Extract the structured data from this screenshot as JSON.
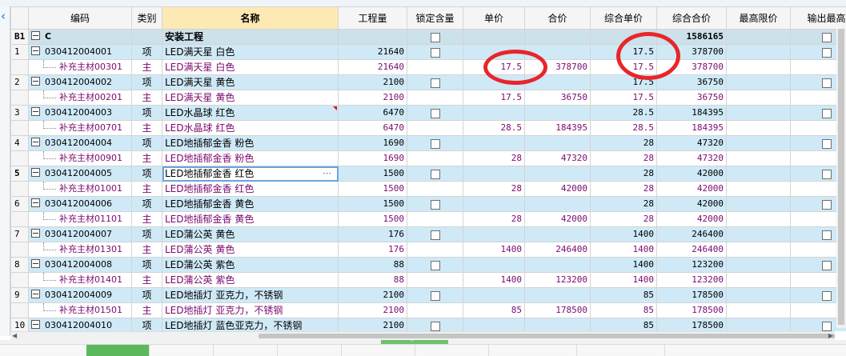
{
  "columns": [
    "编码",
    "类别",
    "名称",
    "工程量",
    "锁定含量",
    "单价",
    "合价",
    "综合单价",
    "综合合价",
    "最高限价",
    "输出最高"
  ],
  "rows": [
    {
      "rn": "B1",
      "code": "C",
      "type": "",
      "name": "安装工程",
      "qty": "",
      "lock": true,
      "price": "",
      "total": "",
      "cprice": "",
      "ctotal": "1586165",
      "kind": "group",
      "tree": true
    },
    {
      "rn": "1",
      "code": "030412004001",
      "type": "项",
      "name": "LED满天星 白色",
      "qty": "21640",
      "lock": true,
      "price": "",
      "total": "",
      "cprice": "17.5",
      "ctotal": "378700",
      "kind": "item",
      "tree": true
    },
    {
      "rn": "",
      "code": "补充主材00301",
      "type": "主",
      "name": "LED满天星 白色",
      "qty": "21640",
      "lock": false,
      "price": "17.5",
      "total": "378700",
      "cprice": "17.5",
      "ctotal": "378700",
      "kind": "sub"
    },
    {
      "rn": "2",
      "code": "030412004002",
      "type": "项",
      "name": "LED满天星 黄色",
      "qty": "2100",
      "lock": true,
      "price": "",
      "total": "",
      "cprice": "17.5",
      "ctotal": "36750",
      "kind": "item",
      "tree": true
    },
    {
      "rn": "",
      "code": "补充主材00201",
      "type": "主",
      "name": "LED满天星 黄色",
      "qty": "2100",
      "lock": false,
      "price": "17.5",
      "total": "36750",
      "cprice": "17.5",
      "ctotal": "36750",
      "kind": "sub"
    },
    {
      "rn": "3",
      "code": "030412004003",
      "type": "项",
      "name": "LED水晶球 红色",
      "qty": "6470",
      "lock": true,
      "price": "",
      "total": "",
      "cprice": "28.5",
      "ctotal": "184395",
      "kind": "item",
      "tree": true,
      "redmark": true
    },
    {
      "rn": "",
      "code": "补充主材00701",
      "type": "主",
      "name": "LED水晶球 红色",
      "qty": "6470",
      "lock": false,
      "price": "28.5",
      "total": "184395",
      "cprice": "28.5",
      "ctotal": "184395",
      "kind": "sub"
    },
    {
      "rn": "4",
      "code": "030412004004",
      "type": "项",
      "name": "LED地插郁金香 粉色",
      "qty": "1690",
      "lock": true,
      "price": "",
      "total": "",
      "cprice": "28",
      "ctotal": "47320",
      "kind": "item",
      "tree": true
    },
    {
      "rn": "",
      "code": "补充主材00901",
      "type": "主",
      "name": "LED地插郁金香 粉色",
      "qty": "1690",
      "lock": false,
      "price": "28",
      "total": "47320",
      "cprice": "28",
      "ctotal": "47320",
      "kind": "sub"
    },
    {
      "rn": "5",
      "code": "030412004005",
      "type": "项",
      "name": "LED地插郁金香 红色",
      "qty": "1500",
      "lock": true,
      "price": "",
      "total": "",
      "cprice": "28",
      "ctotal": "42000",
      "kind": "item",
      "tree": true,
      "current": true
    },
    {
      "rn": "",
      "code": "补充主材01001",
      "type": "主",
      "name": "LED地插郁金香 红色",
      "qty": "1500",
      "lock": false,
      "price": "28",
      "total": "42000",
      "cprice": "28",
      "ctotal": "42000",
      "kind": "sub"
    },
    {
      "rn": "6",
      "code": "030412004006",
      "type": "项",
      "name": "LED地插郁金香 黄色",
      "qty": "1500",
      "lock": true,
      "price": "",
      "total": "",
      "cprice": "28",
      "ctotal": "42000",
      "kind": "item",
      "tree": true
    },
    {
      "rn": "",
      "code": "补充主材01101",
      "type": "主",
      "name": "LED地插郁金香 黄色",
      "qty": "1500",
      "lock": false,
      "price": "28",
      "total": "42000",
      "cprice": "28",
      "ctotal": "42000",
      "kind": "sub"
    },
    {
      "rn": "7",
      "code": "030412004007",
      "type": "项",
      "name": "LED蒲公英 黄色",
      "qty": "176",
      "lock": true,
      "price": "",
      "total": "",
      "cprice": "1400",
      "ctotal": "246400",
      "kind": "item",
      "tree": true
    },
    {
      "rn": "",
      "code": "补充主材01301",
      "type": "主",
      "name": "LED蒲公英 黄色",
      "qty": "176",
      "lock": false,
      "price": "1400",
      "total": "246400",
      "cprice": "1400",
      "ctotal": "246400",
      "kind": "sub"
    },
    {
      "rn": "8",
      "code": "030412004008",
      "type": "项",
      "name": "LED蒲公英 紫色",
      "qty": "88",
      "lock": true,
      "price": "",
      "total": "",
      "cprice": "1400",
      "ctotal": "123200",
      "kind": "item",
      "tree": true
    },
    {
      "rn": "",
      "code": "补充主材01401",
      "type": "主",
      "name": "LED蒲公英 紫色",
      "qty": "88",
      "lock": false,
      "price": "1400",
      "total": "123200",
      "cprice": "1400",
      "ctotal": "123200",
      "kind": "sub"
    },
    {
      "rn": "9",
      "code": "030412004009",
      "type": "项",
      "name": "LED地插灯 亚克力，不锈钢",
      "qty": "2100",
      "lock": true,
      "price": "",
      "total": "",
      "cprice": "85",
      "ctotal": "178500",
      "kind": "item",
      "tree": true
    },
    {
      "rn": "",
      "code": "补充主材01501",
      "type": "主",
      "name": "LED地插灯 亚克力，不锈钢",
      "qty": "2100",
      "lock": false,
      "price": "85",
      "total": "178500",
      "cprice": "85",
      "ctotal": "178500",
      "kind": "sub"
    },
    {
      "rn": "10",
      "code": "030412004010",
      "type": "项",
      "name": "LED地插灯 蓝色亚克力，不锈钢",
      "qty": "2100",
      "lock": true,
      "price": "",
      "total": "",
      "cprice": "85",
      "ctotal": "178500",
      "kind": "item",
      "tree": true
    }
  ],
  "icons": {
    "collapse": "chevron-left-icon",
    "splitter": "chevron-down-icon",
    "tree": "minus-box-icon"
  },
  "colors": {
    "item_row": "#cfe9f7",
    "group_row": "#cde1eb",
    "sub_text": "#7b0a6f",
    "highlight_circle": "#e8262a",
    "name_header": "#fde9b3"
  }
}
